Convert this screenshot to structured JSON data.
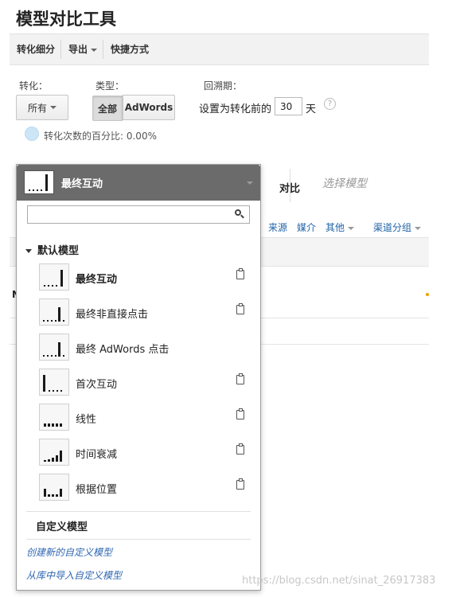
{
  "page": {
    "title": "模型对比工具"
  },
  "toolbar": {
    "items": [
      "转化细分",
      "导出",
      "快捷方式"
    ]
  },
  "filters": {
    "conversion_label": "转化：",
    "conversion_value": "所有",
    "type_label": "类型：",
    "type_options": [
      "全部",
      "AdWords"
    ],
    "type_selected": "全部",
    "lookback_label": "回溯期：",
    "lookback_prefix": "设置为转化前的",
    "lookback_value": "30",
    "lookback_suffix": "天",
    "help": "?"
  },
  "percent": {
    "text": "转化次数的百分比: 0.00%",
    "value": 0.0
  },
  "background": {
    "compare_label": "对比",
    "select_model": "选择模型",
    "tabs": [
      "来源",
      "媒介",
      "其他",
      "渠道分组"
    ],
    "row_letter": "N"
  },
  "dropdown": {
    "header_label": "最终互动",
    "search_placeholder": "",
    "default_section": "默认模型",
    "models": [
      {
        "name": "最终互动",
        "icon": "last-interaction",
        "selected": true,
        "clipboard": true
      },
      {
        "name": "最终非直接点击",
        "icon": "last-non-direct-click",
        "selected": false,
        "clipboard": true
      },
      {
        "name": "最终 AdWords 点击",
        "icon": "last-adwords-click",
        "selected": false,
        "clipboard": false
      },
      {
        "name": "首次互动",
        "icon": "first-interaction",
        "selected": false,
        "clipboard": true
      },
      {
        "name": "线性",
        "icon": "linear",
        "selected": false,
        "clipboard": true
      },
      {
        "name": "时间衰减",
        "icon": "time-decay",
        "selected": false,
        "clipboard": true
      },
      {
        "name": "根据位置",
        "icon": "position-based",
        "selected": false,
        "clipboard": true
      }
    ],
    "custom_section": "自定义模型",
    "links": [
      "创建新的自定义模型",
      "从库中导入自定义模型"
    ]
  },
  "watermark": "https://blog.csdn.net/sinat_26917383",
  "colors": {
    "header_bg": "#6b6b6b",
    "link": "#2f67b0",
    "icon_bar": "#1a1a1a"
  }
}
